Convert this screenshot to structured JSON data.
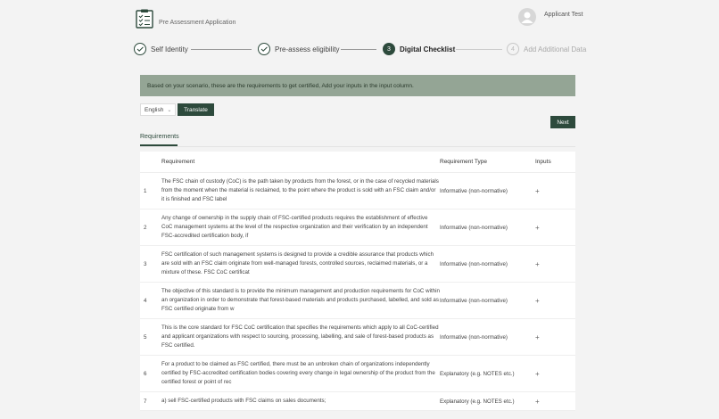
{
  "header": {
    "app_title": "Pre Assessment Application",
    "user_name": "Applicant Test"
  },
  "stepper": {
    "steps": [
      {
        "label": "Self Identity",
        "state": "done",
        "marker": "✓"
      },
      {
        "label": "Pre-assess eligibility",
        "state": "done",
        "marker": "✓"
      },
      {
        "label": "Digital Checklist",
        "state": "active",
        "marker": "3"
      },
      {
        "label": "Add Additional Data",
        "state": "pending",
        "marker": "4"
      }
    ]
  },
  "banner": {
    "text": "Based on your scenario, these are the requirements to get certified, Add your inputs in the input column."
  },
  "language": {
    "selected": "English",
    "translate_label": "Translate"
  },
  "actions": {
    "next_label": "Next"
  },
  "tabs": {
    "requirements": "Requirements"
  },
  "table": {
    "headers": {
      "requirement": "Requirement",
      "type": "Requirement Type",
      "inputs": "Inputs"
    },
    "rows": [
      {
        "num": "1",
        "text": "The FSC chain of custody (CoC) is the path taken by products from the forest, or in the case of recycled materials from the moment when the material is reclaimed, to the point where the product is sold with an FSC claim and/or it is finished and FSC label",
        "type": "Informative (non-normative)",
        "input": "+"
      },
      {
        "num": "2",
        "text": "Any change of ownership in the supply chain of FSC-certified products requires the establishment of effective CoC management systems at the level of the respective organization and their verification by an independent FSC-accredited certification body, if",
        "type": "Informative (non-normative)",
        "input": "+"
      },
      {
        "num": "3",
        "text": "FSC certification of such management systems is designed to provide a credible assurance that products which are sold with an FSC claim originate from well-managed forests, controlled sources, reclaimed materials, or a mixture of these. FSC CoC certificat",
        "type": "Informative (non-normative)",
        "input": "+"
      },
      {
        "num": "4",
        "text": "The objective of this standard is to provide the minimum management and production requirements for CoC within an organization in order to demonstrate that forest-based materials and products purchased, labelled, and sold as FSC certified originate from w",
        "type": "Informative (non-normative)",
        "input": "+"
      },
      {
        "num": "5",
        "text": "This is the core standard for FSC CoC certification that specifies the requirements which apply to all CoC-certified and applicant organizations with respect to sourcing, processing, labelling, and sale of forest-based products as FSC certified.",
        "type": "Informative (non-normative)",
        "input": "+"
      },
      {
        "num": "6",
        "text": "For a product to be claimed as FSC certified, there must be an unbroken chain of organizations independently certified by FSC-accredited certification bodies covering every change in legal ownership of the product from the certified forest or point of rec",
        "type": "Explanatory (e.g. NOTES etc.)",
        "input": "+"
      },
      {
        "num": "7",
        "text": "a) sell FSC-certified products with FSC claims on sales documents;",
        "type": "Explanatory (e.g. NOTES etc.)",
        "input": "+"
      }
    ]
  }
}
